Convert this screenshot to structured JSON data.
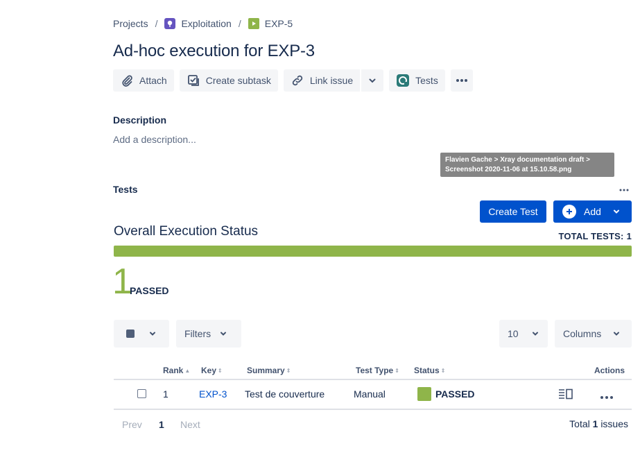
{
  "breadcrumb": {
    "projects": "Projects",
    "separator": "/",
    "project": "Exploitation",
    "issue": "EXP-5",
    "project_icon": "project-avatar-icon",
    "issue_icon": "test-execution-icon"
  },
  "title": "Ad-hoc execution for EXP-3",
  "toolbar": {
    "attach": "Attach",
    "create_subtask": "Create subtask",
    "link_issue": "Link issue",
    "tests": "Tests"
  },
  "description": {
    "label": "Description",
    "placeholder": "Add a description..."
  },
  "tooltip": {
    "line1": "Flavien Gache > Xray documentation draft >",
    "line2": "Screenshot 2020-11-06 at 15.10.58.png"
  },
  "tests_panel": {
    "label": "Tests",
    "create_test": "Create Test",
    "add": "Add",
    "overall_title": "Overall Execution Status",
    "total_tests_label": "TOTAL TESTS:",
    "total_tests_value": "1",
    "passed_count": "1",
    "passed_label": "PASSED",
    "progress_passed_fraction": 1.0
  },
  "filters": {
    "filters_label": "Filters",
    "page_size": "10",
    "columns_label": "Columns"
  },
  "table": {
    "headers": {
      "rank": "Rank",
      "key": "Key",
      "summary": "Summary",
      "test_type": "Test Type",
      "status": "Status",
      "actions": "Actions"
    },
    "rows": [
      {
        "rank": "1",
        "key": "EXP-3",
        "summary": "Test de couverture",
        "test_type": "Manual",
        "status": "PASSED"
      }
    ]
  },
  "pagination": {
    "prev": "Prev",
    "current": "1",
    "next": "Next",
    "total_prefix": "Total",
    "total_count": "1",
    "total_suffix": "issues"
  },
  "colors": {
    "passed": "#8fb54a",
    "primary": "#0052cc",
    "text": "#172b4d"
  }
}
